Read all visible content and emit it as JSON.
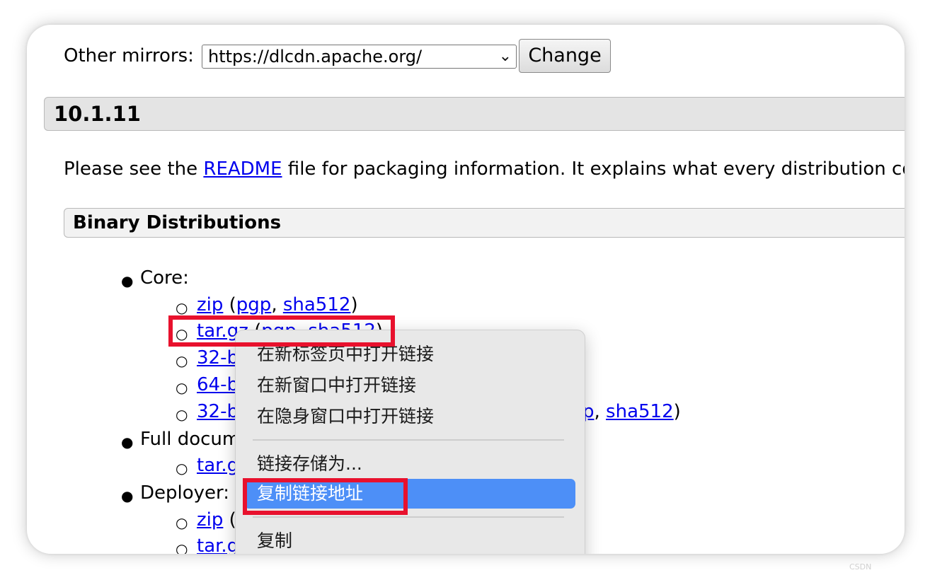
{
  "mirrors": {
    "label": "Other mirrors:",
    "selected": "https://dlcdn.apache.org/",
    "change_label": "Change"
  },
  "version": "10.1.11",
  "readme": {
    "before": "Please see the ",
    "link": "README",
    "after": " file for packaging information. It explains what every distribution co"
  },
  "binary_title": "Binary Distributions",
  "list": {
    "core_label": "Core:",
    "zip_row": {
      "main": "zip",
      "open": " (",
      "pgp": "pgp",
      "comma": ", ",
      "sha": "sha512",
      "close": ")"
    },
    "targz_row": {
      "main": "tar.gz",
      "open": " (",
      "pgp": "pgp",
      "comma": ", ",
      "sha": "sha512",
      "close": ")"
    },
    "row32a": "32-b",
    "row64": "64-b",
    "row32b": "32-b",
    "row32b_tail": {
      "pgp_part": "p",
      "comma": ", ",
      "sha": "sha512",
      "close": ")"
    },
    "fulldoc_label": "Full docum",
    "fulldoc_sub": "tar.g",
    "deployer_label": "Deployer:",
    "deployer_zip": "zip",
    "deployer_zip_paren": " (",
    "deployer_tar": "tar.g"
  },
  "context_menu": {
    "items": [
      "在新标签页中打开链接",
      "在新窗口中打开链接",
      "在隐身窗口中打开链接",
      "链接存储为...",
      "复制链接地址",
      "复制"
    ],
    "highlight_color": "#4d8ff7"
  },
  "annotation_color": "#e8112d",
  "watermark": "CSDN"
}
